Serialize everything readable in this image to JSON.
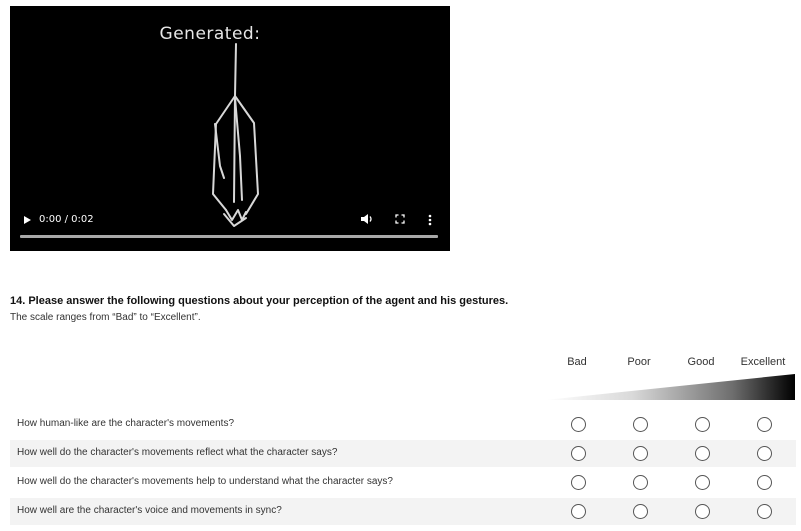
{
  "video": {
    "title": "Generated:",
    "time": "0:00 / 0:02",
    "progress": 0,
    "icons": [
      "play-icon",
      "volume-icon",
      "fullscreen-icon",
      "more-icon"
    ]
  },
  "question": {
    "title": "14. Please answer the following questions about your perception of the agent and his gestures.",
    "description": "The scale ranges from “Bad” to “Excellent”.",
    "columns": [
      "Bad",
      "Poor",
      "Good",
      "Excellent"
    ],
    "rows": [
      "How human-like are the character's movements?",
      "How well do the character's movements reflect what the character says?",
      "How well do the character's movements help to understand what the character says?",
      "How well are the character's voice and movements in sync?"
    ]
  }
}
